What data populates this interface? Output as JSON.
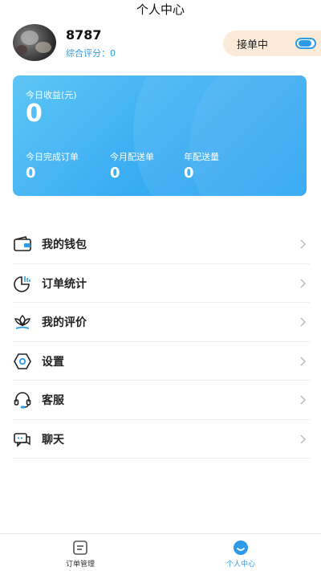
{
  "header": {
    "title": "个人中心"
  },
  "profile": {
    "name": "8787",
    "rating": "综合评分：0"
  },
  "order_toggle": {
    "label": "接单中",
    "on": true
  },
  "earnings": {
    "today_label": "今日收益(元)",
    "today_value": "0",
    "stats": [
      {
        "label": "今日完成订单",
        "value": "0"
      },
      {
        "label": "今月配送单",
        "value": "0"
      },
      {
        "label": "年配送量",
        "value": "0"
      }
    ]
  },
  "menu": {
    "items": [
      {
        "label": "我的钱包",
        "icon": "wallet-icon"
      },
      {
        "label": "订单统计",
        "icon": "chart-icon"
      },
      {
        "label": "我的评价",
        "icon": "review-icon"
      },
      {
        "label": "设置",
        "icon": "settings-icon"
      },
      {
        "label": "客服",
        "icon": "headset-icon"
      },
      {
        "label": "聊天",
        "icon": "chat-icon"
      }
    ]
  },
  "tabbar": {
    "tabs": [
      {
        "label": "订单管理",
        "icon": "order-list-icon",
        "active": false
      },
      {
        "label": "个人中心",
        "icon": "smile-icon",
        "active": true
      }
    ]
  },
  "colors": {
    "accent": "#2d9be8",
    "card_gradient_start": "#5ec6f5",
    "card_gradient_end": "#1f9ff0",
    "toggle_pill_bg": "#fbead7"
  }
}
